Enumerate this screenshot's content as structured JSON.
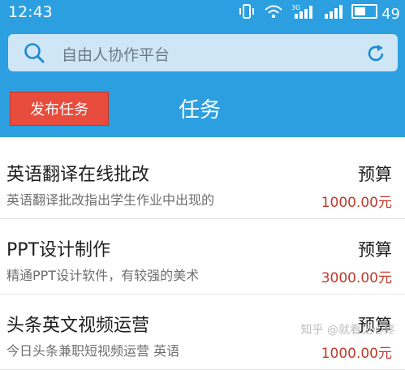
{
  "status_bar": {
    "time": "12:43",
    "network": "3G",
    "battery": "49"
  },
  "search": {
    "placeholder": "自由人协作平台"
  },
  "header": {
    "publish_label": "发布任务",
    "title": "任务"
  },
  "tasks": [
    {
      "title": "英语翻译在线批改",
      "desc": "英语翻译批改指出学生作业中出现的",
      "budget_label": "预算",
      "price": "1000.00元"
    },
    {
      "title": "PPT设计制作",
      "desc": "精通PPT设计软件，有较强的美术",
      "budget_label": "预算",
      "price": "3000.00元"
    },
    {
      "title": "头条英文视频运营",
      "desc": "今日头条兼职短视频运营 英语",
      "budget_label": "预算",
      "price": "1000.00元"
    }
  ],
  "watermark": "知乎 @就看见心疼",
  "colors": {
    "primary": "#2b9fe0",
    "publish_button": "#e84c3d",
    "price": "#c0392b"
  }
}
